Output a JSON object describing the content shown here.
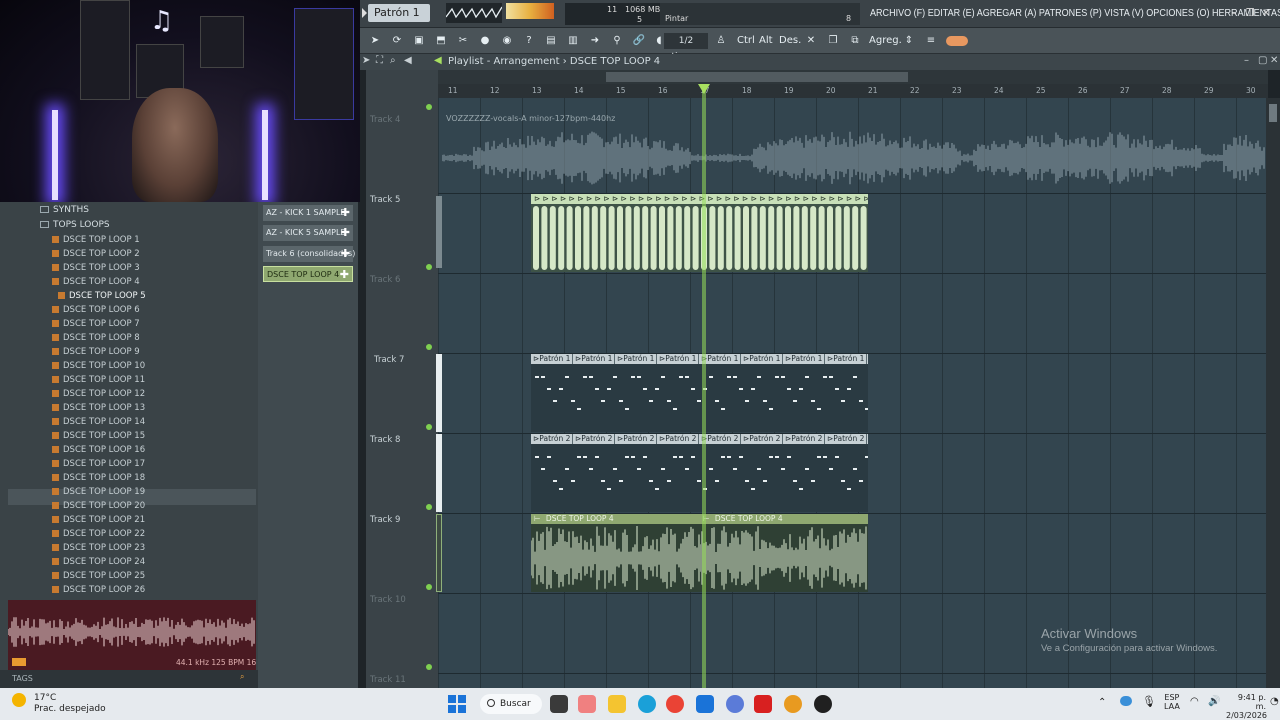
{
  "topbar": {
    "pattern_selector": "Patrón 1",
    "memory_value": "1068 MB",
    "cpu_polyphony": "11",
    "voices": "5",
    "tool_hint": "Pintar",
    "menu_text": "ARCHIVO (F) EDITAR (E) AGREGAR (A) PATRONES (P) VISTA (V) OPCIONES (O) HERRAMIENTAS (T) AYUDA",
    "hint_number": "8"
  },
  "toolbar": {
    "snap_label": "1/2 tiemp.",
    "ctrl_label": "Ctrl",
    "alt_label": "Alt",
    "des_label": "Des.",
    "agreg_label": "Agreg."
  },
  "playlist": {
    "title": "Playlist - Arrangement",
    "breadcrumb_sep": "›",
    "current_pattern": "DSCE TOP LOOP 4",
    "ruler": [
      "11",
      "12",
      "13",
      "14",
      "15",
      "16",
      "17",
      "18",
      "19",
      "20",
      "21",
      "22",
      "23",
      "24",
      "25",
      "26",
      "27",
      "28",
      "29",
      "30"
    ],
    "tracks": [
      {
        "label": "Track 4"
      },
      {
        "label": "Track 5"
      },
      {
        "label": "Track 6"
      },
      {
        "label": "Track 7"
      },
      {
        "label": "Track 8"
      },
      {
        "label": "Track 9"
      },
      {
        "label": "Track 10"
      },
      {
        "label": "Track 11"
      }
    ],
    "vocal_clip": "VOZZZZZZ-vocals-A minor-127bpm-440hz",
    "pattern1_label": "Patrón 1",
    "pattern2_label": "Patrón 2",
    "loop_clip": "DSCE TOP LOOP 4"
  },
  "browser": {
    "folders": [
      "SYNTHS",
      "TOPS LOOPS"
    ],
    "items": [
      "DSCE TOP LOOP 1",
      "DSCE TOP LOOP 2",
      "DSCE TOP LOOP 3",
      "DSCE TOP LOOP 4",
      "DSCE TOP LOOP 5",
      "DSCE TOP LOOP 6",
      "DSCE TOP LOOP 7",
      "DSCE TOP LOOP 8",
      "DSCE TOP LOOP 9",
      "DSCE TOP LOOP 10",
      "DSCE TOP LOOP 11",
      "DSCE TOP LOOP 12",
      "DSCE TOP LOOP 13",
      "DSCE TOP LOOP 14",
      "DSCE TOP LOOP 15",
      "DSCE TOP LOOP 16",
      "DSCE TOP LOOP 17",
      "DSCE TOP LOOP 18",
      "DSCE TOP LOOP 19",
      "DSCE TOP LOOP 20",
      "DSCE TOP LOOP 21",
      "DSCE TOP LOOP 22",
      "DSCE TOP LOOP 23",
      "DSCE TOP LOOP 24",
      "DSCE TOP LOOP 25",
      "DSCE TOP LOOP 26"
    ],
    "selected_item": "DSCE TOP LOOP 5",
    "preview_info": "44.1 kHz 125 BPM 16",
    "tags_label": "TAGS"
  },
  "picker": {
    "items": [
      "AZ - KICK 1 SAMPLE",
      "AZ - KICK 5 SAMPLE",
      "Track 6 (consolidados)",
      "DSCE TOP LOOP 4"
    ],
    "selected": "DSCE TOP LOOP 4"
  },
  "watermark": {
    "title": "Activar Windows",
    "subtitle": "Ve a Configuración para activar Windows."
  },
  "taskbar": {
    "temperature": "17°C",
    "weather": "Prac. despejado",
    "search": "Buscar",
    "lang1": "ESP",
    "lang2": "LAA",
    "time": "9:41 p. m.",
    "date": "2/03/2026"
  },
  "colors": {
    "playhead": "#a8e060",
    "audio_header": "#c8e0b8",
    "selected_picker": "#8fa870",
    "grid": "#33454f"
  }
}
